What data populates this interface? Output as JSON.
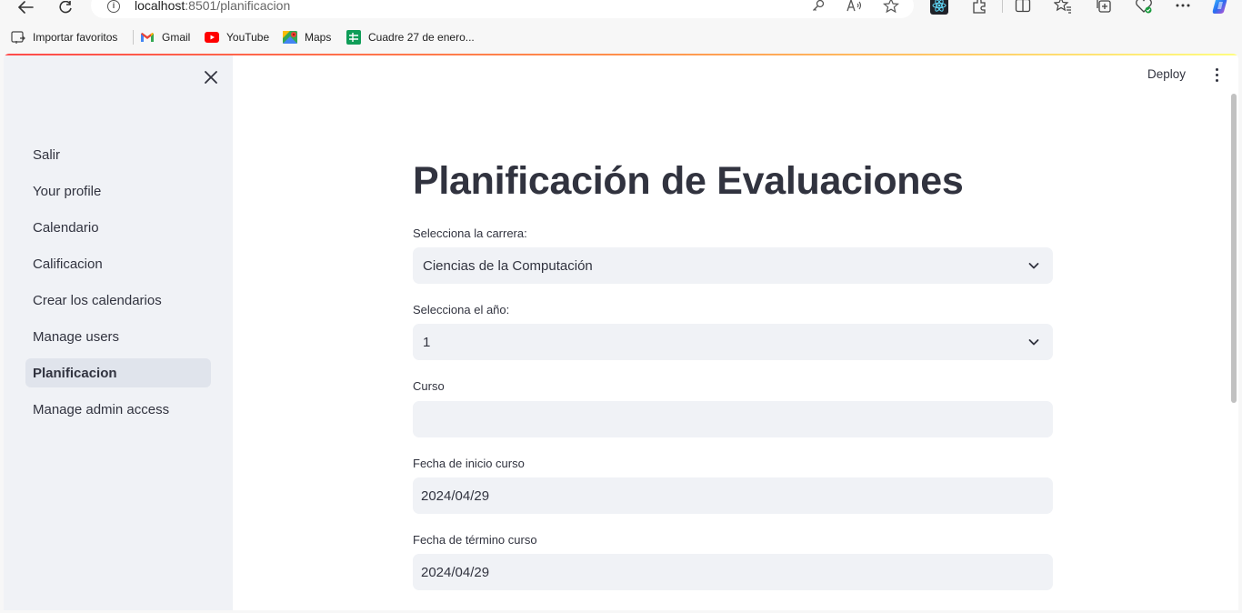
{
  "browser": {
    "url_host": "localhost",
    "url_rest": ":8501/planificacion",
    "bookmarks": [
      {
        "label": "Importar favoritos",
        "icon": "import-icon"
      },
      {
        "label": "Gmail",
        "icon": "gmail-icon"
      },
      {
        "label": "YouTube",
        "icon": "youtube-icon"
      },
      {
        "label": "Maps",
        "icon": "maps-icon"
      },
      {
        "label": "Cuadre 27 de enero...",
        "icon": "sheets-icon"
      }
    ]
  },
  "header": {
    "deploy_label": "Deploy"
  },
  "sidebar": {
    "items": [
      {
        "label": "Salir"
      },
      {
        "label": "Your profile"
      },
      {
        "label": "Calendario"
      },
      {
        "label": "Calificacion"
      },
      {
        "label": "Crear los calendarios"
      },
      {
        "label": "Manage users"
      },
      {
        "label": "Planificacion",
        "active": true
      },
      {
        "label": "Manage admin access"
      }
    ]
  },
  "main": {
    "title": "Planificación de Evaluaciones",
    "fields": [
      {
        "label": "Selecciona la carrera:",
        "value": "Ciencias de la Computación",
        "type": "select"
      },
      {
        "label": "Selecciona el año:",
        "value": "1",
        "type": "select"
      },
      {
        "label": "Curso",
        "value": "",
        "type": "text"
      },
      {
        "label": "Fecha de inicio curso",
        "value": "2024/04/29",
        "type": "date"
      },
      {
        "label": "Fecha de término curso",
        "value": "2024/04/29",
        "type": "date"
      }
    ]
  },
  "colors": {
    "sidebar_bg": "#f0f2f6",
    "input_bg": "#f0f2f6",
    "text": "#31333f",
    "accent_red": "#ff4b4b"
  }
}
